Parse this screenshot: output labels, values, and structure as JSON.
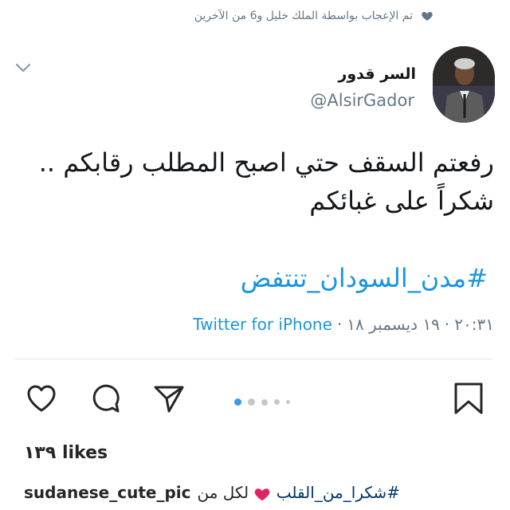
{
  "tweet": {
    "liked_by": "تم الإعجاب بواسطة الملك خليل و6 من الآخرين",
    "display_name": "السر قدور",
    "handle": "@AlsirGador",
    "text_line1": "رفعتم السقف حتي اصبح المطلب رقابكم ..",
    "text_line2": "شكراً على غبائكم",
    "hashtag": "#مدن_السودان_تنتفض",
    "time": "٢٠:٣١ ",
    "sep1": "·",
    "date": " ١٩ ديسمبر ١٨ ",
    "sep2": "·",
    "client": "Twitter for iPhone"
  },
  "post": {
    "likes": "١٣٩ likes",
    "username": "sudanese_cute_pic",
    "caption_tag": "#شكرا_من_القلب",
    "caption_rest": "لكل من"
  },
  "icons": {
    "like": "heart-outline-icon",
    "comment": "comment-bubble-icon",
    "share": "paper-plane-icon",
    "save": "bookmark-icon",
    "chevron": "chevron-down-icon",
    "liked": "heart-filled-icon",
    "emoji": "red-heart-emoji"
  },
  "carousel": {
    "pages": 5,
    "active": 1
  },
  "colors": {
    "link": "#1b95e0",
    "meta": "#657786",
    "heart": "#e0245e",
    "dot_active": "#3897f0"
  }
}
